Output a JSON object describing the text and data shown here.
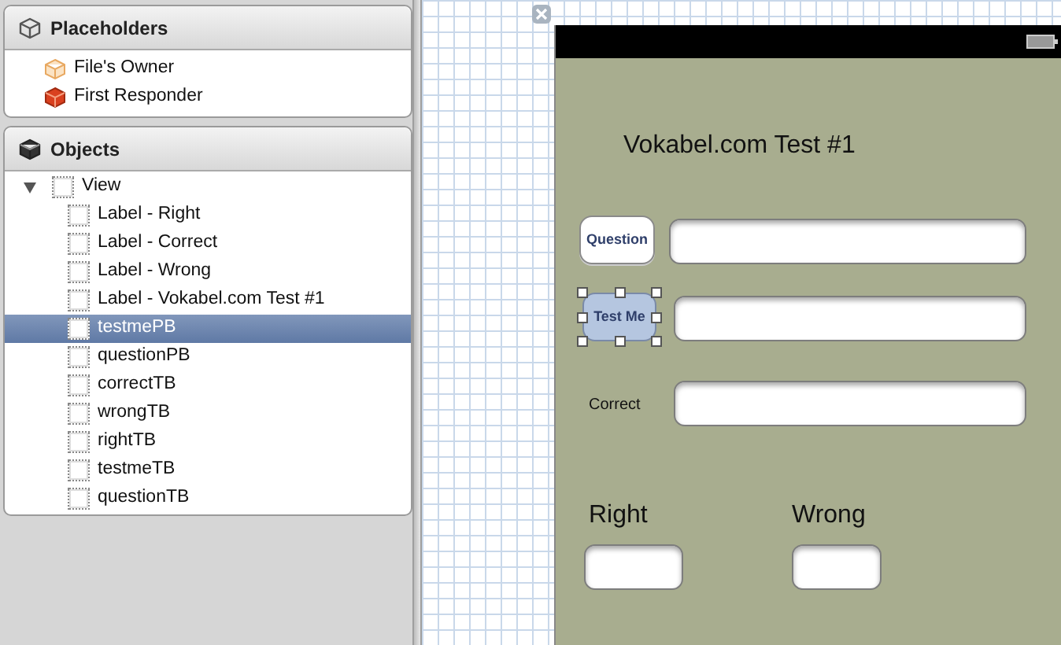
{
  "placeholders": {
    "title": "Placeholders",
    "items": [
      {
        "label": "File's Owner",
        "kind": "owner"
      },
      {
        "label": "First Responder",
        "kind": "responder"
      }
    ]
  },
  "objects": {
    "title": "Objects",
    "tree": [
      {
        "label": "View",
        "expanded": true,
        "selected": false,
        "children": [
          {
            "label": "Label - Right",
            "selected": false
          },
          {
            "label": "Label - Correct",
            "selected": false
          },
          {
            "label": "Label - Wrong",
            "selected": false
          },
          {
            "label": "Label - Vokabel.com Test #1",
            "selected": false
          },
          {
            "label": "testmePB",
            "selected": true
          },
          {
            "label": "questionPB",
            "selected": false
          },
          {
            "label": "correctTB",
            "selected": false
          },
          {
            "label": "wrongTB",
            "selected": false
          },
          {
            "label": "rightTB",
            "selected": false
          },
          {
            "label": "testmeTB",
            "selected": false
          },
          {
            "label": "questionTB",
            "selected": false
          }
        ]
      }
    ]
  },
  "canvas": {
    "elements": [
      {
        "kind": "label",
        "text": "Vokabel.com Test #1"
      },
      {
        "kind": "button",
        "text": "Question",
        "selected": false
      },
      {
        "kind": "field"
      },
      {
        "kind": "button",
        "text": "Test Me",
        "selected": true
      },
      {
        "kind": "field"
      },
      {
        "kind": "small_label",
        "text": "Correct"
      },
      {
        "kind": "field"
      },
      {
        "kind": "label",
        "text": "Right"
      },
      {
        "kind": "label",
        "text": "Wrong"
      },
      {
        "kind": "field"
      },
      {
        "kind": "field"
      }
    ]
  }
}
